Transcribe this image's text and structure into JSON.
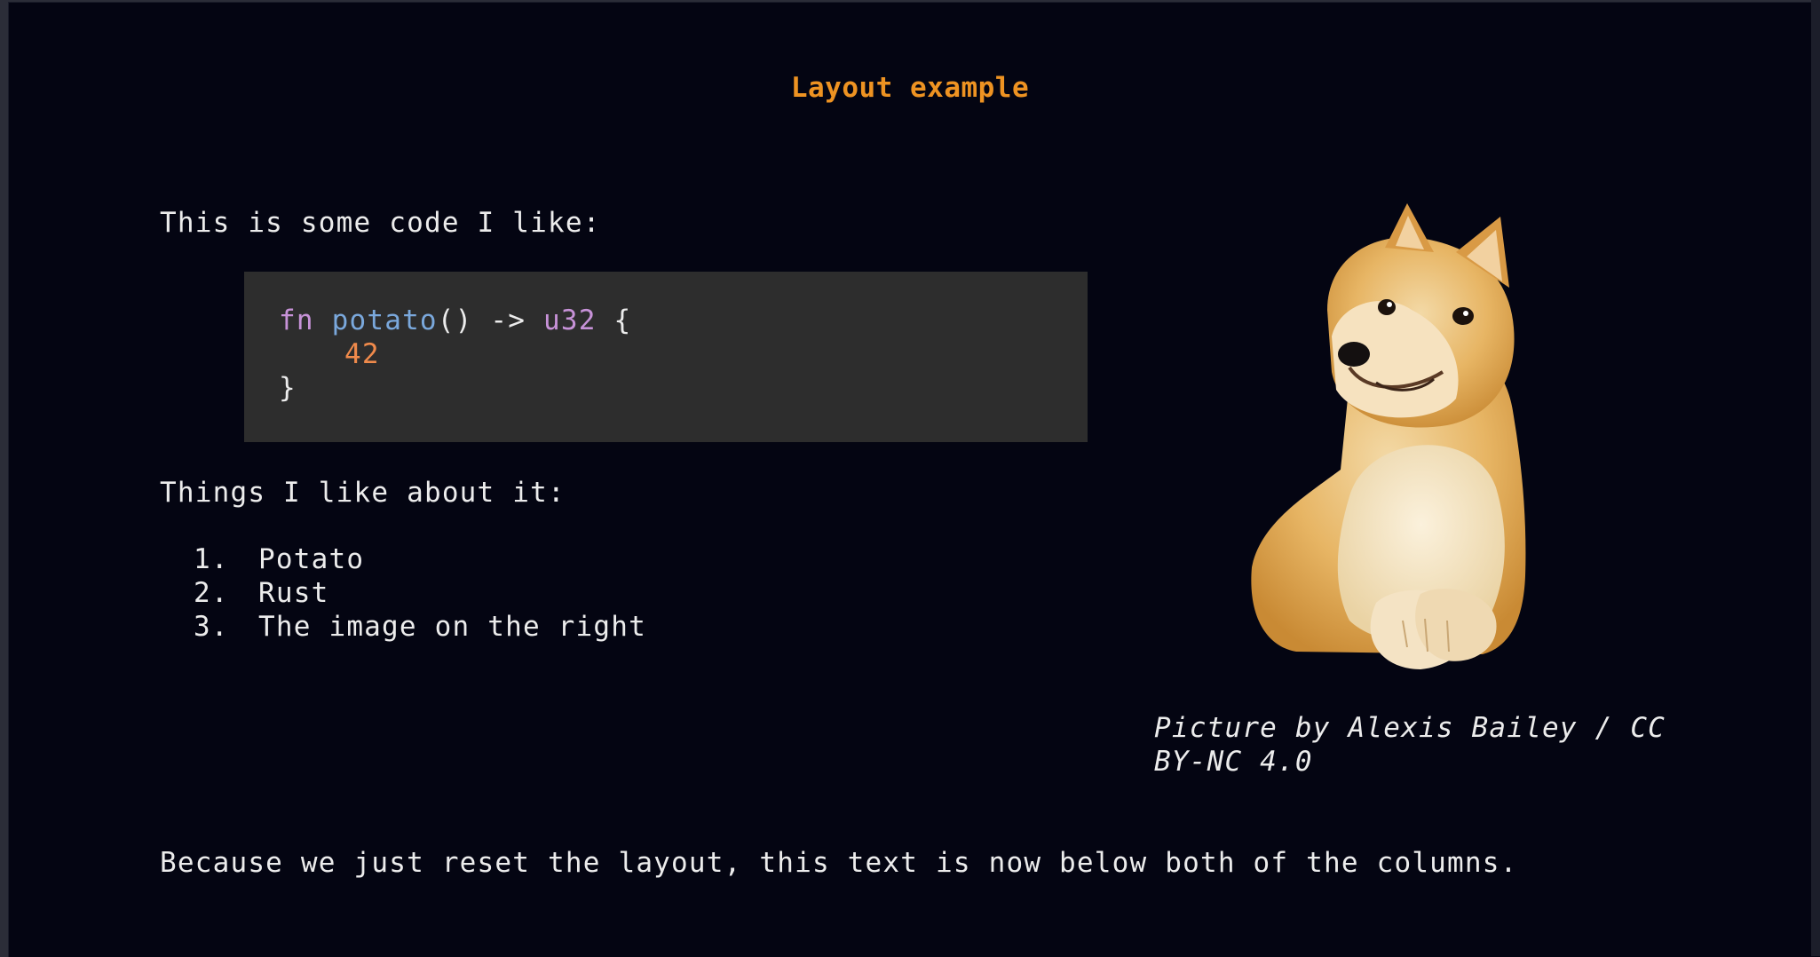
{
  "slide": {
    "title": "Layout example",
    "intro": "This is some code I like:",
    "code": {
      "line1": {
        "kw": "fn",
        "name": "potato",
        "parens": "()",
        "arrow": " -> ",
        "type": "u32",
        "brace": " {"
      },
      "line2": "42",
      "line3": "}"
    },
    "things_heading": "Things I like about it:",
    "list": [
      {
        "num": "1.",
        "label": "Potato"
      },
      {
        "num": "2.",
        "label": "Rust"
      },
      {
        "num": "3.",
        "label": "The image on the right"
      }
    ],
    "caption_line1": "Picture by Alexis Bailey / CC",
    "caption_line2": "BY-NC 4.0",
    "footer": "Because we just reset the layout, this text is now below both of the columns."
  },
  "colors": {
    "background": "#040512",
    "title": "#ee9322",
    "text": "#ececec",
    "code_bg": "#2d2d2d",
    "keyword": "#c792d8",
    "function": "#7aa8dc",
    "number": "#f08a4b"
  }
}
